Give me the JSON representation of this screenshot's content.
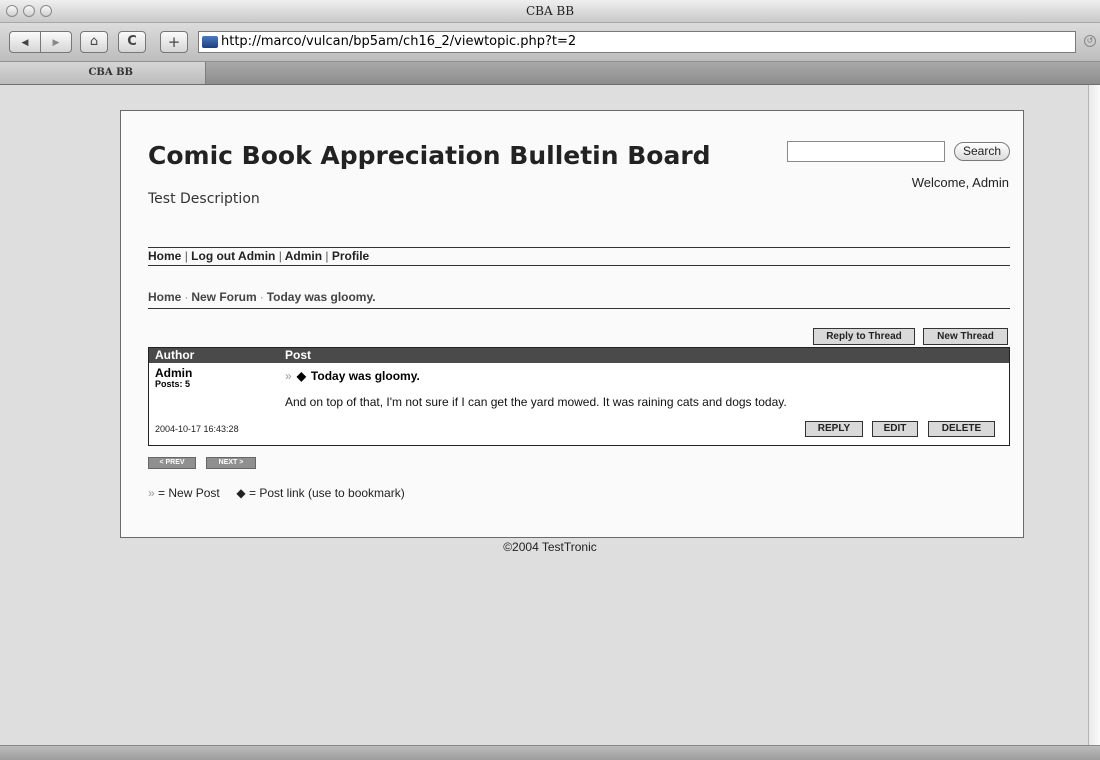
{
  "window": {
    "title": "CBA BB"
  },
  "toolbar": {
    "back_glyph": "◀",
    "forward_glyph": "▶",
    "home_glyph": "⌂",
    "reload_glyph": "C",
    "add_glyph": "+",
    "url": "http://marco/vulcan/bp5am/ch16_2/viewtopic.php?t=2"
  },
  "tabs": [
    {
      "label": "CBA BB"
    }
  ],
  "page": {
    "site_title": "Comic Book Appreciation Bulletin Board",
    "site_description": "Test Description",
    "search": {
      "value": "",
      "button_label": "Search"
    },
    "welcome": "Welcome, Admin",
    "nav": [
      "Home",
      "Log out Admin",
      "Admin",
      "Profile"
    ],
    "nav_separator": "|",
    "breadcrumb": [
      "Home",
      "New Forum",
      "Today was gloomy."
    ],
    "breadcrumb_separator": "·",
    "thread_buttons": {
      "reply": "Reply to Thread",
      "new": "New Thread"
    },
    "table": {
      "headers": [
        "Author",
        "Post"
      ],
      "post": {
        "author": "Admin",
        "posts_count": "Posts: 5",
        "new_marker": "»",
        "link_marker": "◆",
        "title": "Today was gloomy.",
        "body": "And on top of that, I'm not sure if I can get the yard mowed. It was raining cats and dogs today.",
        "date": "2004-10-17 16:43:28",
        "actions": [
          "REPLY",
          "EDIT",
          "DELETE"
        ]
      }
    },
    "pager": {
      "prev": "< PREV",
      "next": "NEXT >"
    },
    "legend": {
      "new_marker": "»",
      "new_text": "= New Post",
      "link_marker": "◆",
      "link_text": "= Post link (use to bookmark)"
    },
    "footer": "©2004 TestTronic"
  }
}
